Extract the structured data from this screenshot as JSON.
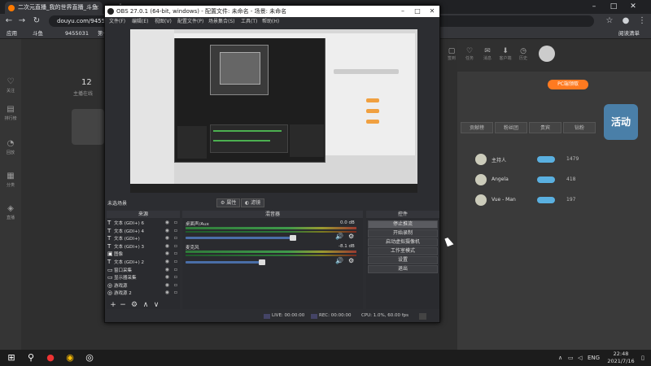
{
  "browser": {
    "tab_title": "二次元直播_我的世界直播_斗鱼",
    "url": "douyu.com/9455031",
    "bookmarks": [
      "应用",
      "斗鱼",
      "9455031",
      "第一章..."
    ],
    "reading_list": "阅读清单"
  },
  "douyu": {
    "left_nav": [
      "关注",
      "排行榜",
      "回放",
      "分类",
      "直播"
    ],
    "room_number_display": "12",
    "room_label": "主播在线",
    "pk_badge": "PC端领取",
    "header_icons": [
      "签到",
      "任务",
      "消息",
      "客户端",
      "历史"
    ],
    "rank_tabs": [
      "贡献榜",
      "粉丝团",
      "贵宾",
      "钻粉"
    ],
    "rank_rows": [
      {
        "name": "主持人",
        "value": "1479"
      },
      {
        "name": "Angela",
        "value": "418"
      },
      {
        "name": "Vue - Man",
        "value": "197"
      }
    ],
    "promo_text": "活动"
  },
  "obs": {
    "title": "OBS 27.0.1 (64-bit, windows) - 配置文件: 未命名 - 场景: 未命名",
    "menu": [
      "文件(F)",
      "编辑(E)",
      "视图(V)",
      "配置文件(P)",
      "场景集合(S)",
      "工具(T)",
      "帮助(H)"
    ],
    "scene_label": "未选场景",
    "properties_btn": "属性",
    "filters_btn": "滤镜",
    "sources_title": "来源",
    "mixer_title": "混音器",
    "controls_title": "控件",
    "sources": [
      {
        "icon": "T",
        "name": "文本 (GDI+) 6"
      },
      {
        "icon": "T",
        "name": "文本 (GDI+) 4"
      },
      {
        "icon": "T",
        "name": "文本 (GDI+)"
      },
      {
        "icon": "T",
        "name": "文本 (GDI+) 3"
      },
      {
        "icon": "▣",
        "name": "图像"
      },
      {
        "icon": "T",
        "name": "文本 (GDI+) 2"
      },
      {
        "icon": "▭",
        "name": "窗口采集"
      },
      {
        "icon": "▭",
        "name": "显示器采集"
      },
      {
        "icon": "◎",
        "name": "游戏源"
      },
      {
        "icon": "◎",
        "name": "游戏源 2"
      }
    ],
    "mixer": [
      {
        "label": "桌面声/Aux",
        "db": "0.0 dB",
        "level": 0.72
      },
      {
        "label": "麦克风",
        "db": "-8.1 dB",
        "level": 0.51
      }
    ],
    "controls": [
      "停止推流",
      "开始录制",
      "启动虚拟摄像机",
      "工作室模式",
      "设置",
      "退出"
    ],
    "status": {
      "live": "LIVE: 00:00:00",
      "rec": "REC: 00:00:00",
      "cpu": "CPU: 1.0%, 60.00 fps"
    }
  },
  "taskbar": {
    "lang": "ENG",
    "time": "22:48",
    "date": "2021/7/16"
  }
}
